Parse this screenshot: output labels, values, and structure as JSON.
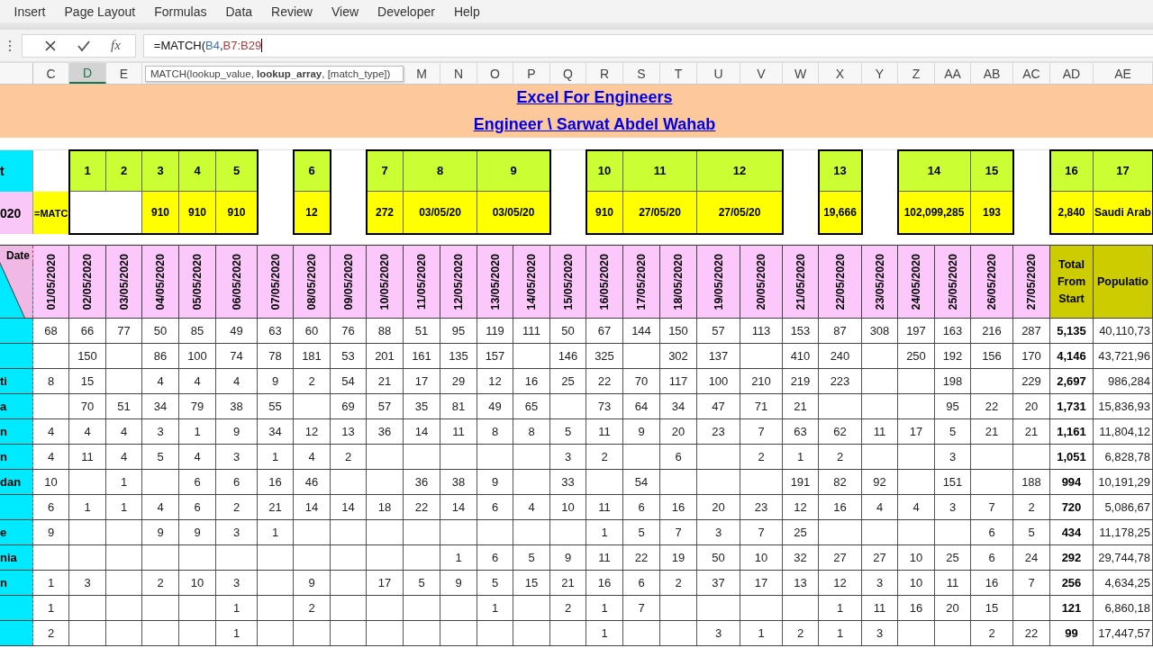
{
  "menu": [
    "Insert",
    "Page Layout",
    "Formulas",
    "Data",
    "Review",
    "View",
    "Developer",
    "Help"
  ],
  "formula_bar": {
    "function_button": "fx",
    "formula_parts": [
      {
        "kind": "plain",
        "text": "=MATCH("
      },
      {
        "kind": "reference",
        "text": "B4",
        "color": "#3b6fc4"
      },
      {
        "kind": "plain",
        "text": ","
      },
      {
        "kind": "reference",
        "text": "B7:B29",
        "color": "#b03a3a"
      }
    ]
  },
  "column_headers_left": [
    {
      "label": "C",
      "selected": false
    },
    {
      "label": "D",
      "selected": true
    },
    {
      "label": "E",
      "selected": false
    }
  ],
  "function_tooltip": "MATCH(lookup_value, **lookup_array**, [match_type])",
  "column_headers_right": [
    {
      "label": "M",
      "selected": false
    },
    {
      "label": "N",
      "selected": false
    },
    {
      "label": "O",
      "selected": false
    },
    {
      "label": "P",
      "selected": false
    },
    {
      "label": "Q",
      "selected": false
    },
    {
      "label": "R",
      "selected": false
    },
    {
      "label": "S",
      "selected": false
    },
    {
      "label": "T",
      "selected": false
    },
    {
      "label": "U",
      "selected": false
    },
    {
      "label": "V",
      "selected": false
    },
    {
      "label": "W",
      "selected": false
    },
    {
      "label": "X",
      "selected": false
    },
    {
      "label": "Y",
      "selected": false
    },
    {
      "label": "Z",
      "selected": false
    },
    {
      "label": "AA",
      "selected": false
    },
    {
      "label": "AB",
      "selected": false
    },
    {
      "label": "AC",
      "selected": false
    },
    {
      "label": "AD",
      "selected": false
    },
    {
      "label": "AE",
      "selected": false
    }
  ],
  "title": "Excel For Engineers",
  "subtitle": "Engineer \\ Sarwat Abdel Wahab",
  "index_row_label": "t",
  "value_row_label": "020",
  "editing_cell": "=MATC",
  "index_boxes": [
    {
      "numbers": [
        {
          "text": "1",
          "wide": false
        },
        {
          "text": "2",
          "wide": false
        },
        {
          "text": "3",
          "wide": false
        },
        {
          "text": "4",
          "wide": false
        },
        {
          "text": "5",
          "wide": false
        }
      ],
      "values": [
        {
          "kind": "blank",
          "wide": true
        },
        {
          "kind": "value",
          "text": "910",
          "wide": false
        },
        {
          "kind": "value",
          "text": "910",
          "wide": false
        },
        {
          "kind": "value",
          "text": "910",
          "wide": false
        }
      ]
    },
    {
      "numbers": [
        {
          "text": "6",
          "wide": false
        }
      ],
      "values": [
        {
          "kind": "value",
          "text": "12",
          "wide": false
        }
      ]
    },
    {
      "numbers": [
        {
          "text": "7",
          "wide": false
        },
        {
          "text": "8",
          "wide": true
        },
        {
          "text": "9",
          "wide": true
        }
      ],
      "values": [
        {
          "kind": "value",
          "text": "272",
          "wide": false
        },
        {
          "kind": "value",
          "text": "03/05/20",
          "wide": true
        },
        {
          "kind": "value",
          "text": "03/05/20",
          "wide": true
        }
      ]
    },
    {
      "numbers": [
        {
          "text": "10",
          "wide": false
        },
        {
          "text": "11",
          "wide": true
        },
        {
          "text": "12",
          "wide": true
        }
      ],
      "values": [
        {
          "kind": "value",
          "text": "910",
          "wide": false
        },
        {
          "kind": "value",
          "text": "27/05/20",
          "wide": true
        },
        {
          "kind": "value",
          "text": "27/05/20",
          "wide": true
        }
      ]
    },
    {
      "numbers": [
        {
          "text": "13",
          "wide": false
        }
      ],
      "values": [
        {
          "kind": "value",
          "text": "19,666",
          "wide": false
        }
      ]
    },
    {
      "numbers": [
        {
          "text": "14",
          "wide": true
        },
        {
          "text": "15",
          "wide": false
        }
      ],
      "values": [
        {
          "kind": "value",
          "text": "102,099,285",
          "wide": true
        },
        {
          "kind": "value",
          "text": "193",
          "wide": false
        }
      ]
    },
    {
      "numbers": [
        {
          "text": "16",
          "wide": false
        },
        {
          "text": "17",
          "wide": false
        }
      ],
      "values": [
        {
          "kind": "value",
          "text": "2,840",
          "wide": false
        },
        {
          "kind": "value",
          "text": "Saudi Arab",
          "wide": false
        }
      ]
    }
  ],
  "table": {
    "corner_label": "Date",
    "dates": [
      "01/05/2020",
      "02/05/2020",
      "03/05/2020",
      "04/05/2020",
      "05/05/2020",
      "06/05/2020",
      "07/05/2020",
      "08/05/2020",
      "09/05/2020",
      "10/05/2020",
      "11/05/2020",
      "12/05/2020",
      "13/05/2020",
      "14/05/2020",
      "15/05/2020",
      "16/05/2020",
      "17/05/2020",
      "18/05/2020",
      "19/05/2020",
      "20/05/2020",
      "21/05/2020",
      "22/05/2020",
      "23/05/2020",
      "24/05/2020",
      "25/05/2020",
      "26/05/2020",
      "27/05/2020"
    ],
    "total_header": "Total From Start",
    "population_header": "Populatio",
    "rows": [
      {
        "cells": [
          {
            "kind": "number",
            "text": "68"
          },
          {
            "kind": "number",
            "text": "66"
          },
          {
            "kind": "number",
            "text": "77"
          },
          {
            "kind": "number",
            "text": "50"
          },
          {
            "kind": "number",
            "text": "85"
          },
          {
            "kind": "number",
            "text": "49"
          },
          {
            "kind": "number",
            "text": "63"
          },
          {
            "kind": "number",
            "text": "60"
          },
          {
            "kind": "number",
            "text": "76"
          },
          {
            "kind": "number",
            "text": "88"
          },
          {
            "kind": "number",
            "text": "51"
          },
          {
            "kind": "number",
            "text": "95"
          },
          {
            "kind": "number",
            "text": "119"
          },
          {
            "kind": "number",
            "text": "111"
          },
          {
            "kind": "number",
            "text": "50"
          },
          {
            "kind": "number",
            "text": "67"
          },
          {
            "kind": "number",
            "text": "144"
          },
          {
            "kind": "number",
            "text": "150"
          },
          {
            "kind": "number",
            "text": "57"
          },
          {
            "kind": "number",
            "text": "113"
          },
          {
            "kind": "number",
            "text": "153"
          },
          {
            "kind": "number",
            "text": "87"
          },
          {
            "kind": "number",
            "text": "308"
          },
          {
            "kind": "number",
            "text": "197"
          },
          {
            "kind": "number",
            "text": "163"
          },
          {
            "kind": "number",
            "text": "216"
          },
          {
            "kind": "number",
            "text": "287"
          }
        ],
        "total": "5,135",
        "population": "40,110,73"
      },
      {
        "cells": [
          {
            "kind": "empty"
          },
          {
            "kind": "number",
            "text": "150"
          },
          {
            "kind": "empty"
          },
          {
            "kind": "number",
            "text": "86"
          },
          {
            "kind": "number",
            "text": "100"
          },
          {
            "kind": "number",
            "text": "74"
          },
          {
            "kind": "number",
            "text": "78"
          },
          {
            "kind": "number",
            "text": "181"
          },
          {
            "kind": "number",
            "text": "53"
          },
          {
            "kind": "number",
            "text": "201"
          },
          {
            "kind": "number",
            "text": "161"
          },
          {
            "kind": "number",
            "text": "135"
          },
          {
            "kind": "number",
            "text": "157"
          },
          {
            "kind": "empty"
          },
          {
            "kind": "number",
            "text": "146"
          },
          {
            "kind": "number",
            "text": "325"
          },
          {
            "kind": "empty"
          },
          {
            "kind": "number",
            "text": "302"
          },
          {
            "kind": "number",
            "text": "137"
          },
          {
            "kind": "empty"
          },
          {
            "kind": "number",
            "text": "410"
          },
          {
            "kind": "number",
            "text": "240"
          },
          {
            "kind": "empty"
          },
          {
            "kind": "number",
            "text": "250"
          },
          {
            "kind": "number",
            "text": "192"
          },
          {
            "kind": "number",
            "text": "156"
          },
          {
            "kind": "number",
            "text": "170"
          }
        ],
        "total": "4,146",
        "population": "43,721,96"
      },
      {
        "name": "ti",
        "cells": [
          {
            "kind": "number",
            "text": "8"
          },
          {
            "kind": "number",
            "text": "15"
          },
          {
            "kind": "empty"
          },
          {
            "kind": "number",
            "text": "4"
          },
          {
            "kind": "number",
            "text": "4"
          },
          {
            "kind": "number",
            "text": "4"
          },
          {
            "kind": "number",
            "text": "9"
          },
          {
            "kind": "number",
            "text": "2"
          },
          {
            "kind": "number",
            "text": "54"
          },
          {
            "kind": "number",
            "text": "21"
          },
          {
            "kind": "number",
            "text": "17"
          },
          {
            "kind": "number",
            "text": "29"
          },
          {
            "kind": "number",
            "text": "12"
          },
          {
            "kind": "number",
            "text": "16"
          },
          {
            "kind": "number",
            "text": "25"
          },
          {
            "kind": "number",
            "text": "22"
          },
          {
            "kind": "number",
            "text": "70"
          },
          {
            "kind": "number",
            "text": "117"
          },
          {
            "kind": "number",
            "text": "100"
          },
          {
            "kind": "number",
            "text": "210"
          },
          {
            "kind": "number",
            "text": "219"
          },
          {
            "kind": "number",
            "text": "223"
          },
          {
            "kind": "empty"
          },
          {
            "kind": "empty"
          },
          {
            "kind": "number",
            "text": "198"
          },
          {
            "kind": "empty"
          },
          {
            "kind": "number",
            "text": "229"
          }
        ],
        "total": "2,697",
        "population": "986,284"
      },
      {
        "name": "a",
        "cells": [
          {
            "kind": "empty"
          },
          {
            "kind": "number",
            "text": "70"
          },
          {
            "kind": "number",
            "text": "51"
          },
          {
            "kind": "number",
            "text": "34"
          },
          {
            "kind": "number",
            "text": "79"
          },
          {
            "kind": "number",
            "text": "38"
          },
          {
            "kind": "number",
            "text": "55"
          },
          {
            "kind": "empty"
          },
          {
            "kind": "number",
            "text": "69"
          },
          {
            "kind": "number",
            "text": "57"
          },
          {
            "kind": "number",
            "text": "35"
          },
          {
            "kind": "number",
            "text": "81"
          },
          {
            "kind": "number",
            "text": "49"
          },
          {
            "kind": "number",
            "text": "65"
          },
          {
            "kind": "empty"
          },
          {
            "kind": "number",
            "text": "73"
          },
          {
            "kind": "number",
            "text": "64"
          },
          {
            "kind": "number",
            "text": "34"
          },
          {
            "kind": "number",
            "text": "47"
          },
          {
            "kind": "number",
            "text": "71"
          },
          {
            "kind": "number",
            "text": "21"
          },
          {
            "kind": "empty"
          },
          {
            "kind": "empty"
          },
          {
            "kind": "empty"
          },
          {
            "kind": "number",
            "text": "95"
          },
          {
            "kind": "number",
            "text": "22"
          },
          {
            "kind": "number",
            "text": "20"
          }
        ],
        "total": "1,731",
        "population": "15,836,93"
      },
      {
        "name": "n",
        "cells": [
          {
            "kind": "number",
            "text": "4"
          },
          {
            "kind": "number",
            "text": "4"
          },
          {
            "kind": "number",
            "text": "4"
          },
          {
            "kind": "number",
            "text": "3"
          },
          {
            "kind": "number",
            "text": "1"
          },
          {
            "kind": "number",
            "text": "9"
          },
          {
            "kind": "number",
            "text": "34"
          },
          {
            "kind": "number",
            "text": "12"
          },
          {
            "kind": "number",
            "text": "13"
          },
          {
            "kind": "number",
            "text": "36"
          },
          {
            "kind": "number",
            "text": "14"
          },
          {
            "kind": "number",
            "text": "11"
          },
          {
            "kind": "number",
            "text": "8"
          },
          {
            "kind": "number",
            "text": "8"
          },
          {
            "kind": "number",
            "text": "5"
          },
          {
            "kind": "number",
            "text": "11"
          },
          {
            "kind": "number",
            "text": "9"
          },
          {
            "kind": "number",
            "text": "20"
          },
          {
            "kind": "number",
            "text": "23"
          },
          {
            "kind": "number",
            "text": "7"
          },
          {
            "kind": "number",
            "text": "63"
          },
          {
            "kind": "number",
            "text": "62"
          },
          {
            "kind": "number",
            "text": "11"
          },
          {
            "kind": "number",
            "text": "17"
          },
          {
            "kind": "number",
            "text": "5"
          },
          {
            "kind": "number",
            "text": "21"
          },
          {
            "kind": "number",
            "text": "21"
          }
        ],
        "total": "1,161",
        "population": "11,804,12"
      },
      {
        "name": "n",
        "cells": [
          {
            "kind": "number",
            "text": "4"
          },
          {
            "kind": "number",
            "text": "11"
          },
          {
            "kind": "number",
            "text": "4"
          },
          {
            "kind": "number",
            "text": "5"
          },
          {
            "kind": "number",
            "text": "4"
          },
          {
            "kind": "number",
            "text": "3"
          },
          {
            "kind": "number",
            "text": "1"
          },
          {
            "kind": "number",
            "text": "4"
          },
          {
            "kind": "number",
            "text": "2"
          },
          {
            "kind": "empty"
          },
          {
            "kind": "empty"
          },
          {
            "kind": "empty"
          },
          {
            "kind": "empty"
          },
          {
            "kind": "empty"
          },
          {
            "kind": "number",
            "text": "3"
          },
          {
            "kind": "number",
            "text": "2"
          },
          {
            "kind": "empty"
          },
          {
            "kind": "number",
            "text": "6"
          },
          {
            "kind": "empty"
          },
          {
            "kind": "number",
            "text": "2"
          },
          {
            "kind": "number",
            "text": "1"
          },
          {
            "kind": "number",
            "text": "2"
          },
          {
            "kind": "empty"
          },
          {
            "kind": "empty"
          },
          {
            "kind": "number",
            "text": "3"
          },
          {
            "kind": "empty"
          },
          {
            "kind": "empty"
          }
        ],
        "total": "1,051",
        "population": "6,828,78"
      },
      {
        "name": "dan",
        "cells": [
          {
            "kind": "number",
            "text": "10"
          },
          {
            "kind": "empty"
          },
          {
            "kind": "number",
            "text": "1"
          },
          {
            "kind": "empty"
          },
          {
            "kind": "number",
            "text": "6"
          },
          {
            "kind": "number",
            "text": "6"
          },
          {
            "kind": "number",
            "text": "16"
          },
          {
            "kind": "number",
            "text": "46"
          },
          {
            "kind": "empty"
          },
          {
            "kind": "empty"
          },
          {
            "kind": "number",
            "text": "36"
          },
          {
            "kind": "number",
            "text": "38"
          },
          {
            "kind": "number",
            "text": "9"
          },
          {
            "kind": "empty"
          },
          {
            "kind": "number",
            "text": "33"
          },
          {
            "kind": "empty"
          },
          {
            "kind": "number",
            "text": "54"
          },
          {
            "kind": "empty"
          },
          {
            "kind": "empty"
          },
          {
            "kind": "empty"
          },
          {
            "kind": "number",
            "text": "191"
          },
          {
            "kind": "number",
            "text": "82"
          },
          {
            "kind": "number",
            "text": "92"
          },
          {
            "kind": "empty"
          },
          {
            "kind": "number",
            "text": "151"
          },
          {
            "kind": "empty"
          },
          {
            "kind": "number",
            "text": "188"
          }
        ],
        "total": "994",
        "population": "10,191,29"
      },
      {
        "cells": [
          {
            "kind": "number",
            "text": "6"
          },
          {
            "kind": "number",
            "text": "1"
          },
          {
            "kind": "number",
            "text": "1"
          },
          {
            "kind": "number",
            "text": "4"
          },
          {
            "kind": "number",
            "text": "6"
          },
          {
            "kind": "number",
            "text": "2"
          },
          {
            "kind": "number",
            "text": "21"
          },
          {
            "kind": "number",
            "text": "14"
          },
          {
            "kind": "number",
            "text": "14"
          },
          {
            "kind": "number",
            "text": "18"
          },
          {
            "kind": "number",
            "text": "22"
          },
          {
            "kind": "number",
            "text": "14"
          },
          {
            "kind": "number",
            "text": "6"
          },
          {
            "kind": "number",
            "text": "4"
          },
          {
            "kind": "number",
            "text": "10"
          },
          {
            "kind": "number",
            "text": "11"
          },
          {
            "kind": "number",
            "text": "6"
          },
          {
            "kind": "number",
            "text": "16"
          },
          {
            "kind": "number",
            "text": "20"
          },
          {
            "kind": "number",
            "text": "23"
          },
          {
            "kind": "number",
            "text": "12"
          },
          {
            "kind": "number",
            "text": "16"
          },
          {
            "kind": "number",
            "text": "4"
          },
          {
            "kind": "number",
            "text": "4"
          },
          {
            "kind": "number",
            "text": "3"
          },
          {
            "kind": "number",
            "text": "7"
          },
          {
            "kind": "number",
            "text": "2"
          }
        ],
        "total": "720",
        "population": "5,086,67"
      },
      {
        "name": "e",
        "cells": [
          {
            "kind": "number",
            "text": "9"
          },
          {
            "kind": "empty"
          },
          {
            "kind": "empty"
          },
          {
            "kind": "number",
            "text": "9"
          },
          {
            "kind": "number",
            "text": "9"
          },
          {
            "kind": "number",
            "text": "3"
          },
          {
            "kind": "number",
            "text": "1"
          },
          {
            "kind": "empty"
          },
          {
            "kind": "empty"
          },
          {
            "kind": "empty"
          },
          {
            "kind": "empty"
          },
          {
            "kind": "empty"
          },
          {
            "kind": "empty"
          },
          {
            "kind": "empty"
          },
          {
            "kind": "empty"
          },
          {
            "kind": "number",
            "text": "1"
          },
          {
            "kind": "number",
            "text": "5"
          },
          {
            "kind": "number",
            "text": "7"
          },
          {
            "kind": "number",
            "text": "3"
          },
          {
            "kind": "number",
            "text": "7"
          },
          {
            "kind": "number",
            "text": "25"
          },
          {
            "kind": "empty"
          },
          {
            "kind": "empty"
          },
          {
            "kind": "empty"
          },
          {
            "kind": "empty"
          },
          {
            "kind": "number",
            "text": "6"
          },
          {
            "kind": "number",
            "text": "5"
          }
        ],
        "total": "434",
        "population": "11,178,25"
      },
      {
        "name": "nia",
        "cells": [
          {
            "kind": "empty"
          },
          {
            "kind": "empty"
          },
          {
            "kind": "empty"
          },
          {
            "kind": "empty"
          },
          {
            "kind": "empty"
          },
          {
            "kind": "empty"
          },
          {
            "kind": "empty"
          },
          {
            "kind": "empty"
          },
          {
            "kind": "empty"
          },
          {
            "kind": "empty"
          },
          {
            "kind": "empty"
          },
          {
            "kind": "number",
            "text": "1"
          },
          {
            "kind": "number",
            "text": "6"
          },
          {
            "kind": "number",
            "text": "5"
          },
          {
            "kind": "number",
            "text": "9"
          },
          {
            "kind": "number",
            "text": "11"
          },
          {
            "kind": "number",
            "text": "22"
          },
          {
            "kind": "number",
            "text": "19"
          },
          {
            "kind": "number",
            "text": "50"
          },
          {
            "kind": "number",
            "text": "10"
          },
          {
            "kind": "number",
            "text": "32"
          },
          {
            "kind": "number",
            "text": "27"
          },
          {
            "kind": "number",
            "text": "27"
          },
          {
            "kind": "number",
            "text": "10"
          },
          {
            "kind": "number",
            "text": "25"
          },
          {
            "kind": "number",
            "text": "6"
          },
          {
            "kind": "number",
            "text": "24"
          }
        ],
        "total": "292",
        "population": "29,744,78"
      },
      {
        "name": "n",
        "cells": [
          {
            "kind": "number",
            "text": "1"
          },
          {
            "kind": "number",
            "text": "3"
          },
          {
            "kind": "empty"
          },
          {
            "kind": "number",
            "text": "2"
          },
          {
            "kind": "number",
            "text": "10"
          },
          {
            "kind": "number",
            "text": "3"
          },
          {
            "kind": "empty"
          },
          {
            "kind": "number",
            "text": "9"
          },
          {
            "kind": "empty"
          },
          {
            "kind": "number",
            "text": "17"
          },
          {
            "kind": "number",
            "text": "5"
          },
          {
            "kind": "number",
            "text": "9"
          },
          {
            "kind": "number",
            "text": "5"
          },
          {
            "kind": "number",
            "text": "15"
          },
          {
            "kind": "number",
            "text": "21"
          },
          {
            "kind": "number",
            "text": "16"
          },
          {
            "kind": "number",
            "text": "6"
          },
          {
            "kind": "number",
            "text": "2"
          },
          {
            "kind": "number",
            "text": "37"
          },
          {
            "kind": "number",
            "text": "17"
          },
          {
            "kind": "number",
            "text": "13"
          },
          {
            "kind": "number",
            "text": "12"
          },
          {
            "kind": "number",
            "text": "3"
          },
          {
            "kind": "number",
            "text": "10"
          },
          {
            "kind": "number",
            "text": "11"
          },
          {
            "kind": "number",
            "text": "16"
          },
          {
            "kind": "number",
            "text": "7"
          }
        ],
        "total": "256",
        "population": "4,634,25"
      },
      {
        "cells": [
          {
            "kind": "number",
            "text": "1"
          },
          {
            "kind": "empty"
          },
          {
            "kind": "empty"
          },
          {
            "kind": "empty"
          },
          {
            "kind": "empty"
          },
          {
            "kind": "number",
            "text": "1"
          },
          {
            "kind": "empty"
          },
          {
            "kind": "number",
            "text": "2"
          },
          {
            "kind": "empty"
          },
          {
            "kind": "empty"
          },
          {
            "kind": "empty"
          },
          {
            "kind": "empty"
          },
          {
            "kind": "number",
            "text": "1"
          },
          {
            "kind": "empty"
          },
          {
            "kind": "number",
            "text": "2"
          },
          {
            "kind": "number",
            "text": "1"
          },
          {
            "kind": "number",
            "text": "7"
          },
          {
            "kind": "empty"
          },
          {
            "kind": "empty"
          },
          {
            "kind": "empty"
          },
          {
            "kind": "empty"
          },
          {
            "kind": "number",
            "text": "1"
          },
          {
            "kind": "number",
            "text": "11"
          },
          {
            "kind": "number",
            "text": "16"
          },
          {
            "kind": "number",
            "text": "20"
          },
          {
            "kind": "number",
            "text": "15"
          },
          {
            "kind": "empty"
          }
        ],
        "total": "121",
        "population": "6,860,18"
      },
      {
        "cells": [
          {
            "kind": "number",
            "text": "2"
          },
          {
            "kind": "empty"
          },
          {
            "kind": "empty"
          },
          {
            "kind": "empty"
          },
          {
            "kind": "empty"
          },
          {
            "kind": "number",
            "text": "1"
          },
          {
            "kind": "empty"
          },
          {
            "kind": "empty"
          },
          {
            "kind": "empty"
          },
          {
            "kind": "empty"
          },
          {
            "kind": "empty"
          },
          {
            "kind": "empty"
          },
          {
            "kind": "empty"
          },
          {
            "kind": "empty"
          },
          {
            "kind": "empty"
          },
          {
            "kind": "number",
            "text": "1"
          },
          {
            "kind": "empty"
          },
          {
            "kind": "empty"
          },
          {
            "kind": "number",
            "text": "3"
          },
          {
            "kind": "number",
            "text": "1"
          },
          {
            "kind": "number",
            "text": "2"
          },
          {
            "kind": "number",
            "text": "1"
          },
          {
            "kind": "number",
            "text": "3"
          },
          {
            "kind": "empty"
          },
          {
            "kind": "empty"
          },
          {
            "kind": "number",
            "text": "2"
          },
          {
            "kind": "number",
            "text": "22"
          }
        ],
        "total": "99",
        "population": "17,447,57"
      }
    ]
  }
}
